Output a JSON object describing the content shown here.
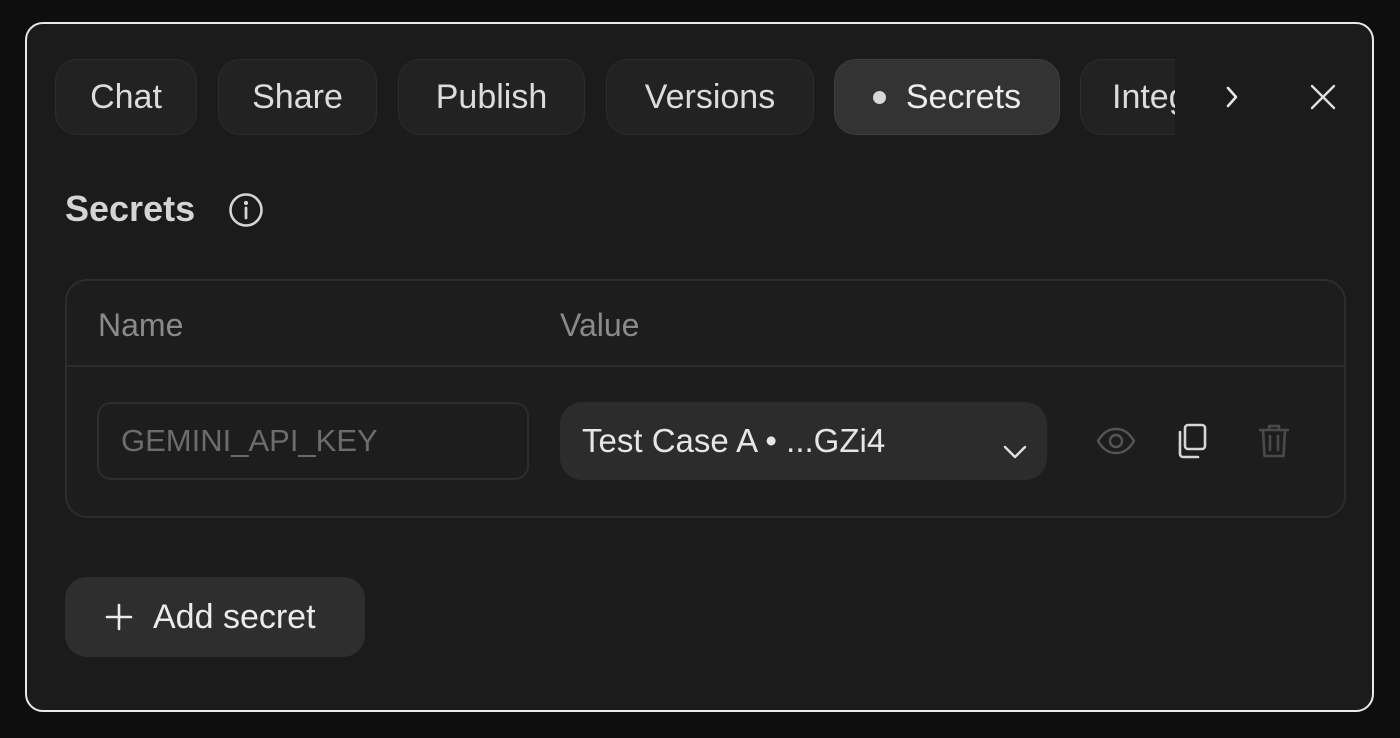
{
  "tabs": [
    {
      "label": "Chat",
      "active": false
    },
    {
      "label": "Share",
      "active": false
    },
    {
      "label": "Publish",
      "active": false
    },
    {
      "label": "Versions",
      "active": false
    },
    {
      "label": "Secrets",
      "active": true
    },
    {
      "label": "Integrations",
      "active": false
    }
  ],
  "section": {
    "title": "Secrets"
  },
  "table": {
    "headers": {
      "name": "Name",
      "value": "Value"
    },
    "rows": [
      {
        "name": "",
        "name_placeholder": "GEMINI_API_KEY",
        "value": "Test Case A • ...GZi4"
      }
    ]
  },
  "actions": {
    "add_label": "Add secret"
  },
  "icons": {
    "scroll_right": "chevron-right-icon",
    "close": "close-icon",
    "info": "info-icon",
    "dropdown": "chevron-down-icon",
    "reveal": "eye-icon",
    "copy": "copy-icon",
    "delete": "trash-icon",
    "add": "plus-icon"
  },
  "colors": {
    "background": "#1b1b1b",
    "active_tab": "#333333",
    "tab": "#222222",
    "border": "#2d2d2d"
  }
}
